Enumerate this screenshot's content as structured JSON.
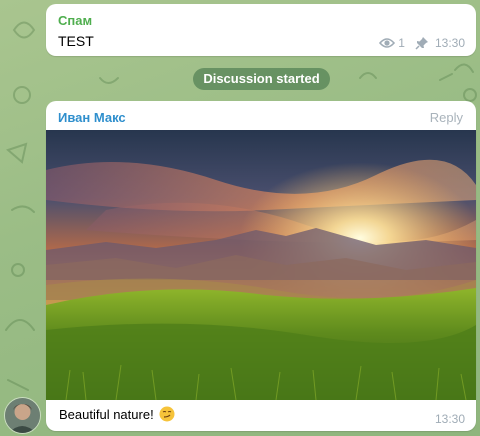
{
  "messages": [
    {
      "sender": "Спам",
      "text": "TEST",
      "views": "1",
      "time": "13:30",
      "icons": [
        "eye-icon",
        "pin-icon"
      ]
    },
    {
      "sender": "Иван Макс",
      "reply_label": "Reply",
      "caption": "Beautiful nature!",
      "emoji": "smirk-emoji",
      "time": "13:30",
      "photo": "sunset-mountain-meadow"
    }
  ],
  "service_message": "Discussion started",
  "colors": {
    "sender1": "#4fae4e",
    "sender2": "#2f8fcd",
    "meta": "#a0acb6",
    "service_bg": "#5f8d62"
  }
}
